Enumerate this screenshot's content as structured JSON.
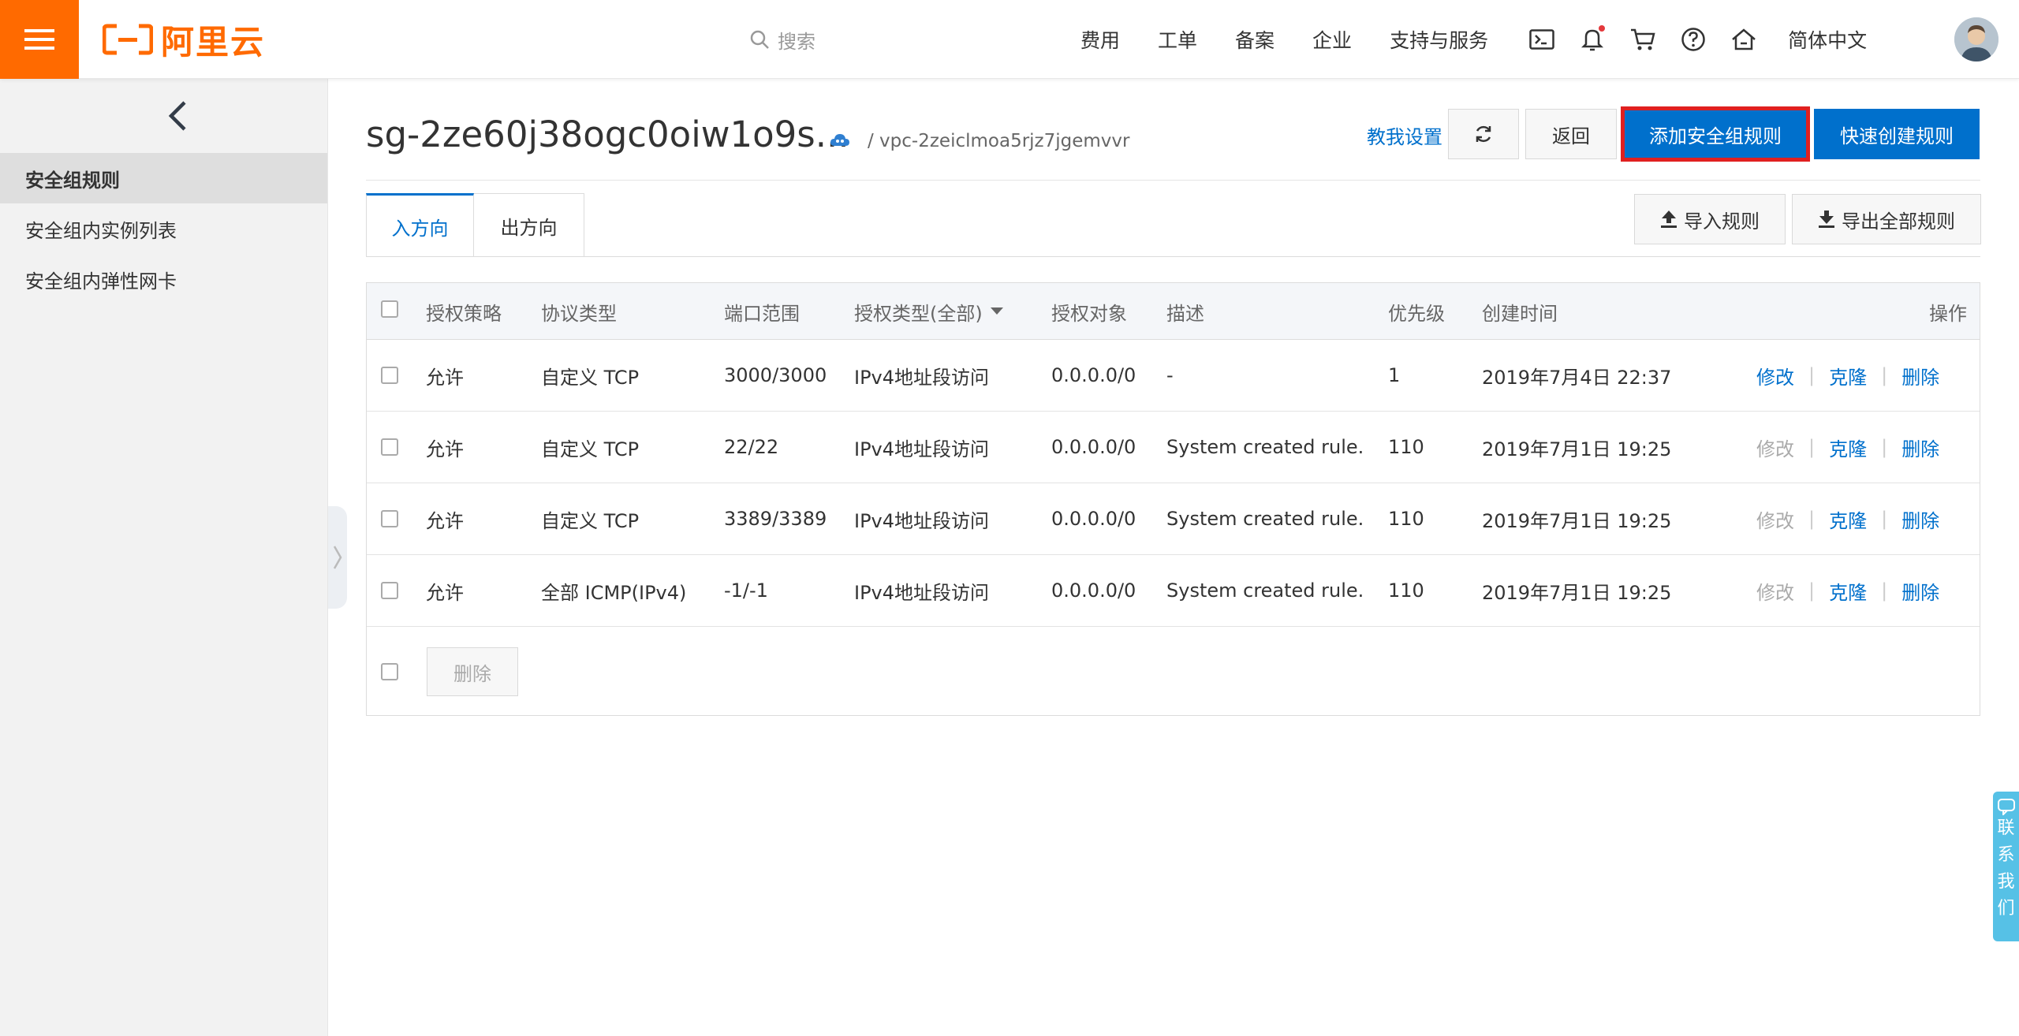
{
  "brand": {
    "logo_text": "阿里云",
    "accent": "#ff6a00",
    "primary": "#0070cc"
  },
  "topbar": {
    "search_placeholder": "搜索",
    "nav": [
      "费用",
      "工单",
      "备案",
      "企业",
      "支持与服务"
    ],
    "icons": [
      "terminal-icon",
      "bell-icon",
      "cart-icon",
      "help-icon",
      "home-icon"
    ],
    "language": "简体中文"
  },
  "sidebar": {
    "items": [
      {
        "label": "安全组规则",
        "active": true
      },
      {
        "label": "安全组内实例列表",
        "active": false
      },
      {
        "label": "安全组内弹性网卡",
        "active": false
      }
    ]
  },
  "header": {
    "title": "sg-2ze60j38ogc0oiw1o9s...",
    "vpc": "/ vpc-2zeiclmoa5rjz7jgemvvr",
    "settings_link": "教我设置",
    "back_label": "返回",
    "add_rule_label": "添加安全组规则",
    "quick_create_label": "快速创建规则"
  },
  "tabs": {
    "inbound": "入方向",
    "outbound": "出方向"
  },
  "toolbar": {
    "import_label": "导入规则",
    "export_label": "导出全部规则"
  },
  "table": {
    "columns": {
      "policy": "授权策略",
      "protocol": "协议类型",
      "port": "端口范围",
      "auth_type": "授权类型(全部)",
      "target": "授权对象",
      "desc": "描述",
      "priority": "优先级",
      "created": "创建时间",
      "ops": "操作"
    },
    "rows": [
      {
        "policy": "允许",
        "protocol": "自定义 TCP",
        "port": "3000/3000",
        "auth_type": "IPv4地址段访问",
        "target": "0.0.0.0/0",
        "desc": "-",
        "priority": "1",
        "created": "2019年7月4日 22:37",
        "edit": "修改",
        "edit_enabled": true,
        "clone": "克隆",
        "delete": "删除"
      },
      {
        "policy": "允许",
        "protocol": "自定义 TCP",
        "port": "22/22",
        "auth_type": "IPv4地址段访问",
        "target": "0.0.0.0/0",
        "desc": "System created rule.",
        "priority": "110",
        "created": "2019年7月1日 19:25",
        "edit": "修改",
        "edit_enabled": false,
        "clone": "克隆",
        "delete": "删除"
      },
      {
        "policy": "允许",
        "protocol": "自定义 TCP",
        "port": "3389/3389",
        "auth_type": "IPv4地址段访问",
        "target": "0.0.0.0/0",
        "desc": "System created rule.",
        "priority": "110",
        "created": "2019年7月1日 19:25",
        "edit": "修改",
        "edit_enabled": false,
        "clone": "克隆",
        "delete": "删除"
      },
      {
        "policy": "允许",
        "protocol": "全部 ICMP(IPv4)",
        "port": "-1/-1",
        "auth_type": "IPv4地址段访问",
        "target": "0.0.0.0/0",
        "desc": "System created rule.",
        "priority": "110",
        "created": "2019年7月1日 19:25",
        "edit": "修改",
        "edit_enabled": false,
        "clone": "克隆",
        "delete": "删除"
      }
    ],
    "bulk_delete_label": "删除"
  },
  "contact": {
    "chars": [
      "联",
      "系",
      "我",
      "们"
    ]
  }
}
